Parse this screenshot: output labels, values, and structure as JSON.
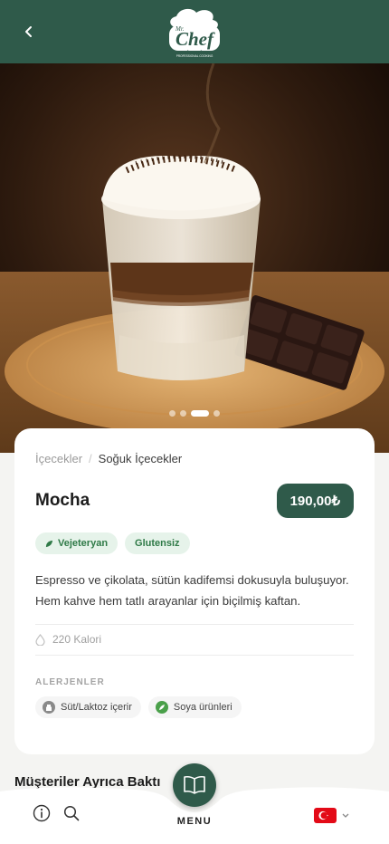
{
  "header": {
    "back_icon": "chevron-left-icon",
    "logo_text": "Chef",
    "logo_small_text": "Mr.",
    "logo_tagline": "PROFESSIONAL COOKING",
    "color": "#2f5a4a"
  },
  "hero": {
    "image": "mocha-layered-glass-on-wooden-board",
    "slide_count": 4,
    "active_slide_index": 2
  },
  "product": {
    "breadcrumb": [
      "İçecekler",
      "Soğuk İçecekler"
    ],
    "breadcrumb_separator": "/",
    "name": "Mocha",
    "price": "190,00₺",
    "tags": [
      {
        "label": "Vejeteryan",
        "icon": "leaf-icon"
      },
      {
        "label": "Glutensiz",
        "icon": ""
      }
    ],
    "description": "Espresso ve çikolata, sütün kadifemsi dokusuyla buluşuyor. Hem kahve hem tatlı arayanlar için biçilmiş kaftan.",
    "calories": "220 Kalori",
    "allergens_heading": "ALERJENLER",
    "allergens": [
      {
        "label": "Süt/Laktoz içerir",
        "icon": "milk-icon"
      },
      {
        "label": "Soya ürünleri",
        "icon": "soy-icon"
      }
    ]
  },
  "also_bought_title": "Müşteriler Ayrıca Baktı",
  "bottom_nav": {
    "menu_label": "MENU",
    "info_icon": "info-icon",
    "search_icon": "search-icon",
    "menu_icon": "book-icon",
    "language_flag": "turkey-flag-icon"
  },
  "colors": {
    "brand_green": "#2f5a4a",
    "tag_bg": "#e6f3ea",
    "tag_text": "#2f7a47"
  }
}
